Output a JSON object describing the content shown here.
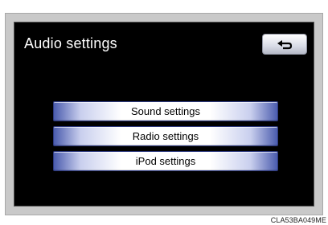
{
  "header": {
    "title": "Audio settings",
    "back_icon": "back-arrow-icon"
  },
  "menu": {
    "items": [
      {
        "label": "Sound settings"
      },
      {
        "label": "Radio settings"
      },
      {
        "label": "iPod settings"
      }
    ]
  },
  "footer": {
    "reference_code": "CLA53BA049ME"
  },
  "colors": {
    "screen_background": "#000000",
    "title_text": "#ffffff",
    "button_edge_blue": "#4b5cae"
  }
}
